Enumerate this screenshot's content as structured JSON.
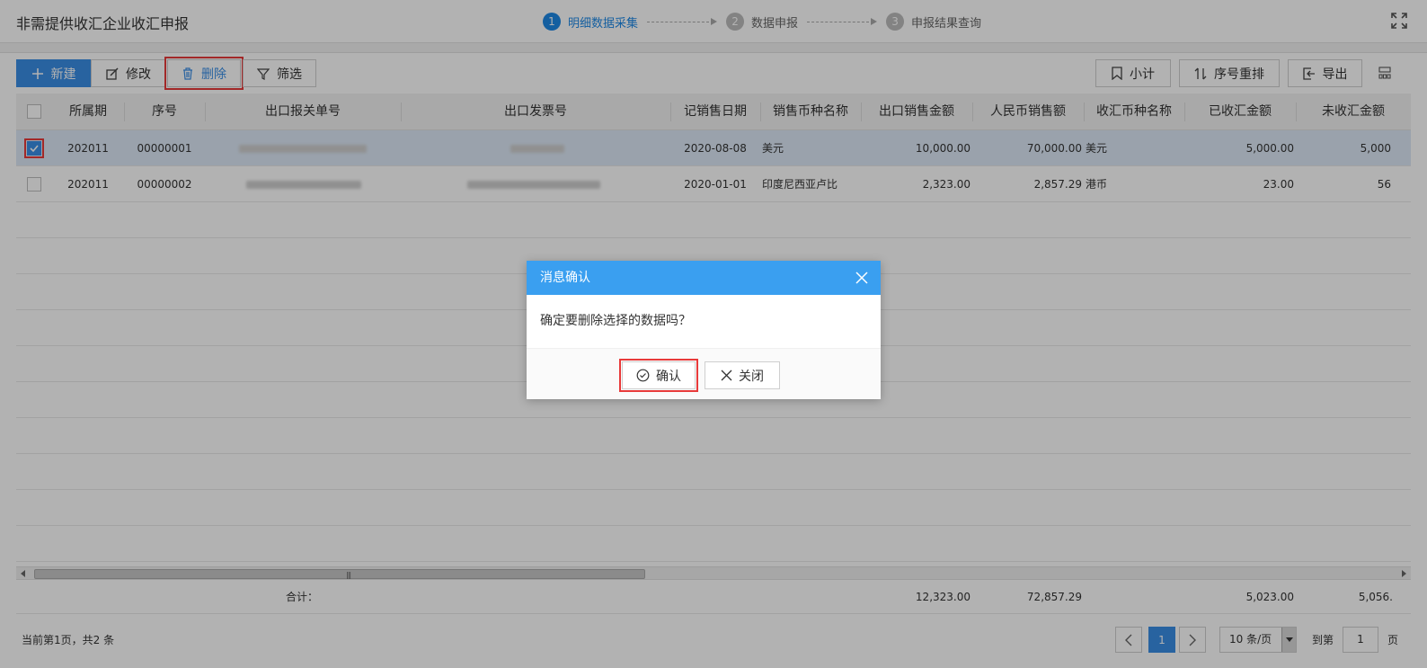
{
  "header": {
    "title": "非需提供收汇企业收汇申报",
    "steps": [
      {
        "num": "1",
        "label": "明细数据采集"
      },
      {
        "num": "2",
        "label": "数据申报"
      },
      {
        "num": "3",
        "label": "申报结果查询"
      }
    ]
  },
  "toolbar": {
    "new_label": "新建",
    "edit_label": "修改",
    "delete_label": "删除",
    "filter_label": "筛选",
    "subtotal_label": "小计",
    "reorder_label": "序号重排",
    "export_label": "导出"
  },
  "table": {
    "columns": [
      "所属期",
      "序号",
      "出口报关单号",
      "出口发票号",
      "记销售日期",
      "销售币种名称",
      "出口销售金额",
      "人民币销售额",
      "收汇币种名称",
      "已收汇金额",
      "未收汇金额"
    ],
    "rows": [
      {
        "period": "202011",
        "seq": "00000001",
        "sale_date": "2020-08-08",
        "sale_currency": "美元",
        "export_amount": "10,000.00",
        "rmb_amount": "70,000.00",
        "receipt_currency": "美元",
        "received": "5,000.00",
        "unreceived": "5,000",
        "selected": true
      },
      {
        "period": "202011",
        "seq": "00000002",
        "sale_date": "2020-01-01",
        "sale_currency": "印度尼西亚卢比",
        "export_amount": "2,323.00",
        "rmb_amount": "2,857.29",
        "receipt_currency": "港币",
        "received": "23.00",
        "unreceived": "56",
        "selected": false
      }
    ],
    "summary": {
      "label": "合计：",
      "export_amount": "12,323.00",
      "rmb_amount": "72,857.29",
      "received": "5,023.00",
      "unreceived": "5,056."
    }
  },
  "pager": {
    "info": "当前第1页，共2 条",
    "current_page": "1",
    "page_size": "10 条/页",
    "goto_label": "到第",
    "goto_value": "1",
    "unit": "页"
  },
  "dialog": {
    "title": "消息确认",
    "message": "确定要删除选择的数据吗？",
    "confirm_label": "确认",
    "close_label": "关闭"
  },
  "colors": {
    "accent": "#3a8ee6",
    "dialog_header": "#3a9ff0",
    "highlight": "#e83a3a"
  }
}
